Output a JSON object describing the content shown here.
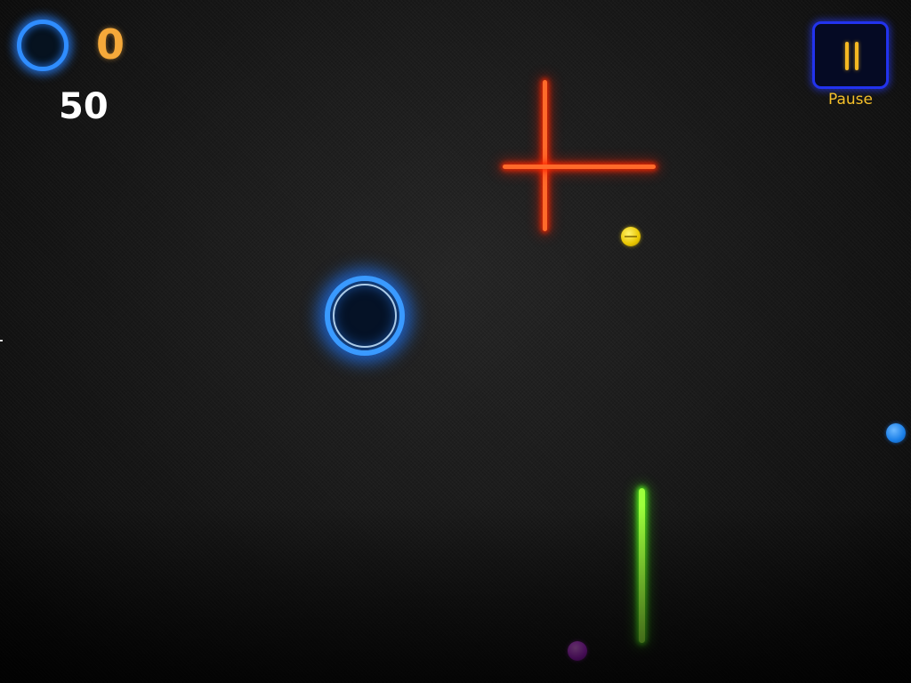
{
  "hud": {
    "score": "0",
    "count": "50",
    "ring_icon": "blue-ring-icon"
  },
  "pause": {
    "label": "Pause",
    "icon": "pause-icon"
  },
  "colors": {
    "player_ring": "#3a9aff",
    "score_text": "#f5a93a",
    "count_text": "#ffffff",
    "pause_border": "#2233ee",
    "pause_accent": "#f5b822",
    "red_obstacle": "#ff4a1a",
    "green_obstacle": "#8cff2e",
    "yellow_dot": "#e9c600",
    "blue_dot": "#1a7fe8",
    "purple_dot": "#b520e0"
  }
}
